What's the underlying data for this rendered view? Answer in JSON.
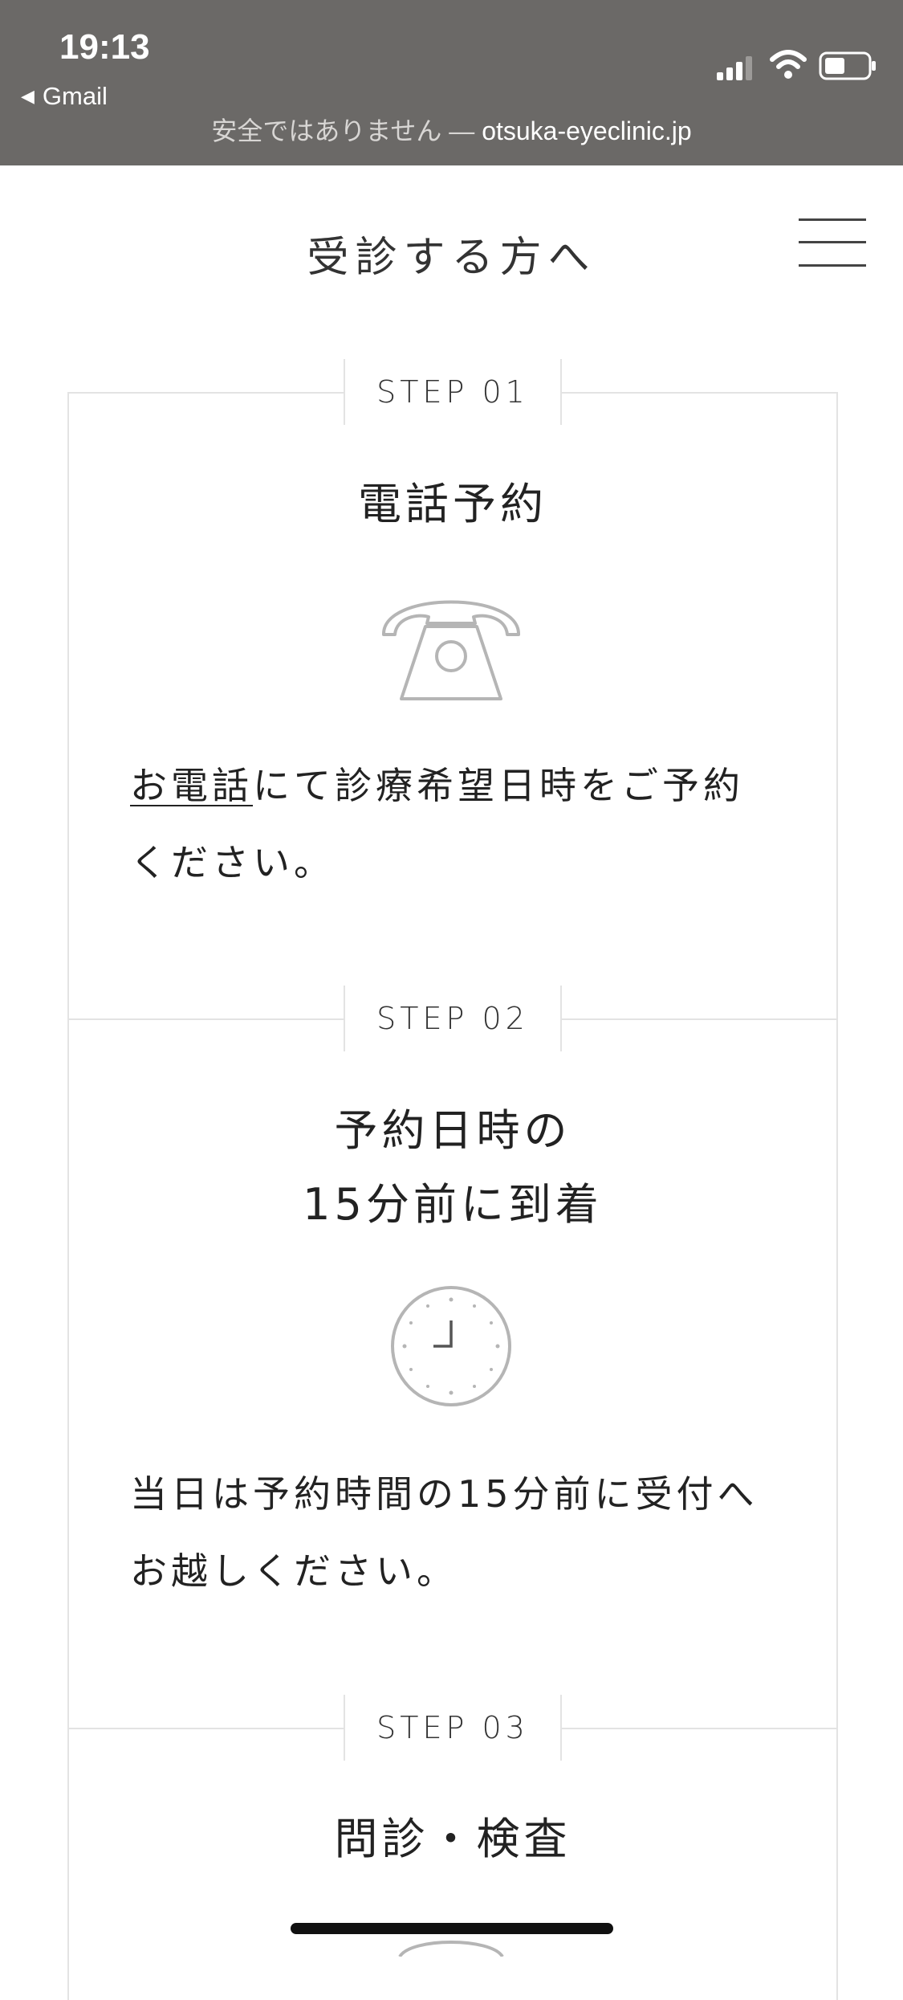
{
  "status_bar": {
    "time": "19:13",
    "back_app": "Gmail",
    "url_security": "安全ではありません — ",
    "url_host": "otsuka-eyeclinic.jp"
  },
  "header": {
    "title": "受診する方へ",
    "menu_icon": "hamburger-menu-icon"
  },
  "steps": [
    {
      "label": "STEP 01",
      "title": "電話予約",
      "icon": "telephone-icon",
      "text_link": "お電話",
      "text_line1": "にて診療希望日時をご予約",
      "text_line2": "ください。"
    },
    {
      "label": "STEP 02",
      "title_line1": "予約日時の",
      "title_line2": "15分前に到着",
      "icon": "clock-icon",
      "text_line1": "当日は予約時間の15分前に受付へ",
      "text_line2": "お越しください。"
    },
    {
      "label": "STEP 03",
      "title": "問診・検査",
      "icon": "partial-icon"
    }
  ],
  "colors": {
    "status_bar_bg": "#6b6967",
    "border": "#e3e3e3",
    "icon_stroke": "#b5b5b5",
    "text": "#222222"
  }
}
